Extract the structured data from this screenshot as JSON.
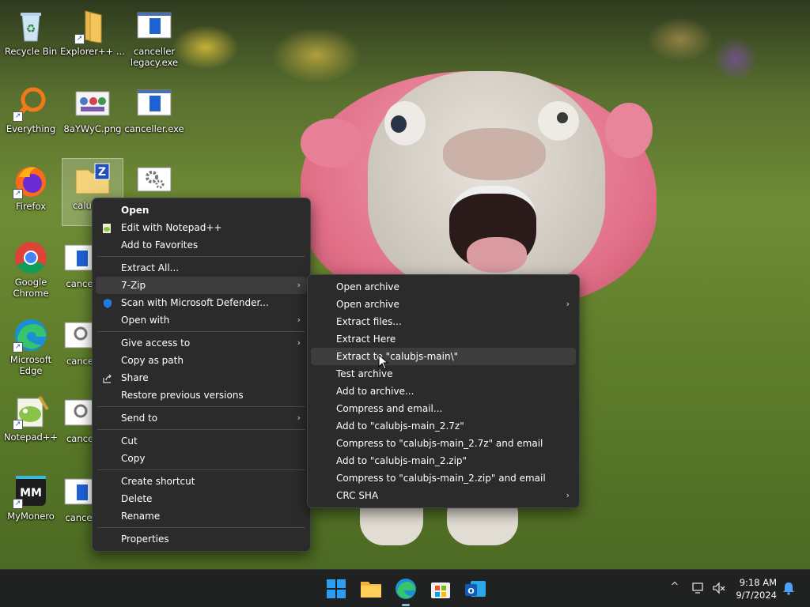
{
  "desktop": {
    "icons": [
      {
        "label": "Recycle Bin",
        "icon": "recycle-bin-icon"
      },
      {
        "label": "Explorer++ ...",
        "icon": "folder-icon"
      },
      {
        "label": "canceller legacy.exe",
        "icon": "exe-icon"
      },
      {
        "label": "Everything",
        "icon": "magnifier-icon"
      },
      {
        "label": "8aYWyC.png",
        "icon": "image-icon"
      },
      {
        "label": "canceller.exe",
        "icon": "exe-icon"
      },
      {
        "label": "Firefox",
        "icon": "firefox-icon"
      },
      {
        "label": "calubjs z",
        "icon": "zip-folder-icon"
      },
      {
        "label": "",
        "icon": "settings-exe-icon"
      },
      {
        "label": "Google Chrome",
        "icon": "chrome-icon"
      },
      {
        "label": "cancel",
        "icon": "exe-icon"
      },
      {
        "label": "Microsoft Edge",
        "icon": "edge-icon"
      },
      {
        "label": "cance",
        "icon": "exe-icon"
      },
      {
        "label": "Notepad++",
        "icon": "notepadpp-icon"
      },
      {
        "label": "cance",
        "icon": "exe-icon"
      },
      {
        "label": "MyMonero",
        "icon": "mymonero-icon"
      },
      {
        "label": "cancel",
        "icon": "exe-icon"
      }
    ]
  },
  "context_menu": {
    "items": [
      {
        "label": "Open",
        "bold": true
      },
      {
        "label": "Edit with Notepad++",
        "icon": "notepadpp-icon"
      },
      {
        "label": "Add to Favorites"
      },
      {
        "label": "Extract All..."
      },
      {
        "label": "7-Zip",
        "submenu": true
      },
      {
        "label": "Scan with Microsoft Defender...",
        "icon": "defender-shield-icon"
      },
      {
        "label": "Open with",
        "submenu": true
      },
      {
        "label": "Give access to",
        "submenu": true
      },
      {
        "label": "Copy as path"
      },
      {
        "label": "Share",
        "icon": "share-icon"
      },
      {
        "label": "Restore previous versions"
      },
      {
        "label": "Send to",
        "submenu": true
      },
      {
        "label": "Cut"
      },
      {
        "label": "Copy"
      },
      {
        "label": "Create shortcut"
      },
      {
        "label": "Delete"
      },
      {
        "label": "Rename"
      },
      {
        "label": "Properties"
      }
    ],
    "arrow_glyph": "›"
  },
  "zip_submenu": {
    "items": [
      {
        "label": "Open archive"
      },
      {
        "label": "Open archive",
        "submenu": true
      },
      {
        "label": "Extract files..."
      },
      {
        "label": "Extract Here"
      },
      {
        "label": "Extract to \"calubjs-main\\\"",
        "hover": true
      },
      {
        "label": "Test archive"
      },
      {
        "label": "Add to archive..."
      },
      {
        "label": "Compress and email..."
      },
      {
        "label": "Add to \"calubjs-main_2.7z\""
      },
      {
        "label": "Compress to \"calubjs-main_2.7z\" and email"
      },
      {
        "label": "Add to \"calubjs-main_2.zip\""
      },
      {
        "label": "Compress to \"calubjs-main_2.zip\" and email"
      },
      {
        "label": "CRC SHA",
        "submenu": true
      }
    ]
  },
  "taskbar": {
    "apps": [
      "windows-start-icon",
      "file-explorer-icon",
      "edge-icon",
      "microsoft-store-icon",
      "outlook-icon"
    ],
    "clock": {
      "time": "9:18 AM",
      "date": "9/7/2024"
    },
    "tray_chevron": "^"
  },
  "colors": {
    "menu_bg": "#2b2b2b",
    "menu_hover": "#3d3d3d",
    "taskbar_bg": "#1f2220",
    "accent": "#0078d4"
  }
}
